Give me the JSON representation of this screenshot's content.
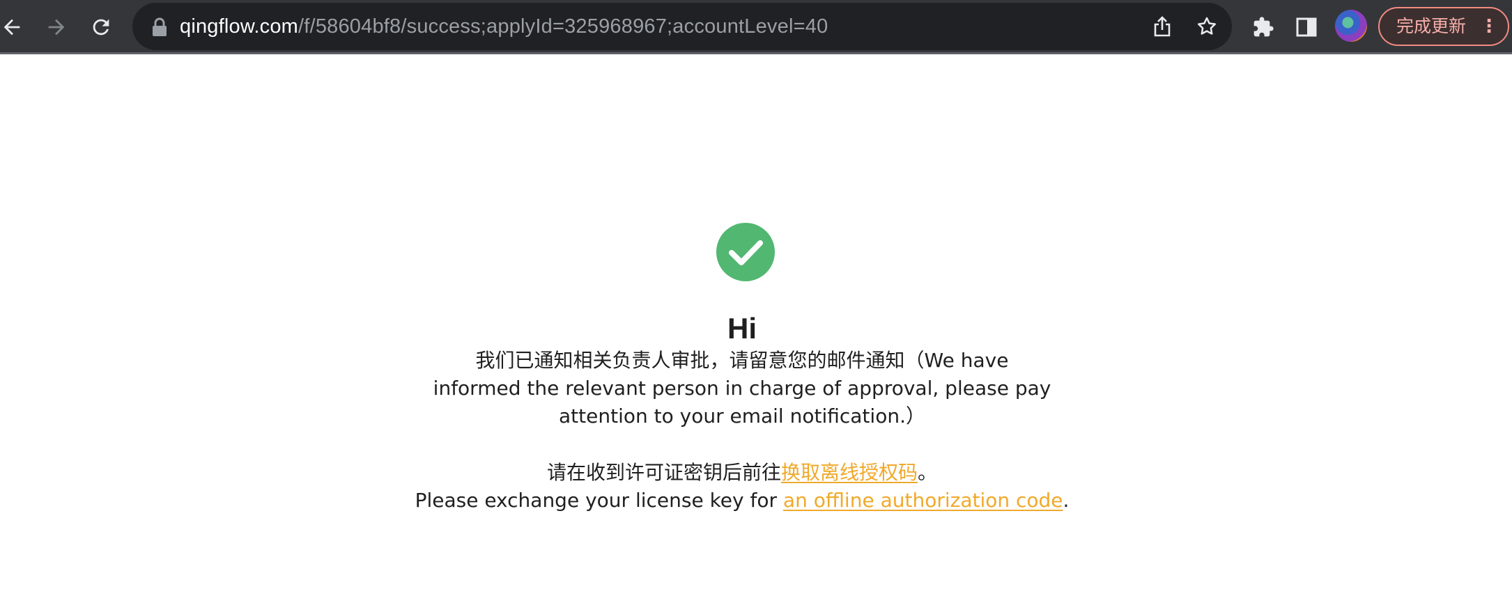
{
  "browser": {
    "url_host": "qingflow.com",
    "url_path": "/f/58604bf8/success;applyId=325968967;accountLevel=40",
    "update_button_label": "完成更新",
    "menu_icon": "⋮",
    "icons": [
      "back-arrow-icon",
      "forward-arrow-icon",
      "reload-icon",
      "lock-icon",
      "share-icon",
      "star-icon",
      "extensions-icon",
      "side-panel-icon",
      "profile-avatar",
      "more-menu-icon"
    ]
  },
  "page": {
    "status_icon": "check-circle-icon",
    "accent_color": "#52b771",
    "link_color": "#f0a92a",
    "heading": "Hi",
    "message": "我们已通知相关负责人审批，请留意您的邮件通知（We have informed the relevant person in charge of approval, please pay attention to your email notification.）",
    "exchange_prefix_cn": "请在收到许可证密钥后前往",
    "exchange_link_cn": "换取离线授权码",
    "exchange_suffix_cn": "。",
    "exchange_prefix_en": "Please exchange your license key for ",
    "exchange_link_en": "an offline authorization code",
    "exchange_suffix_en": "."
  }
}
